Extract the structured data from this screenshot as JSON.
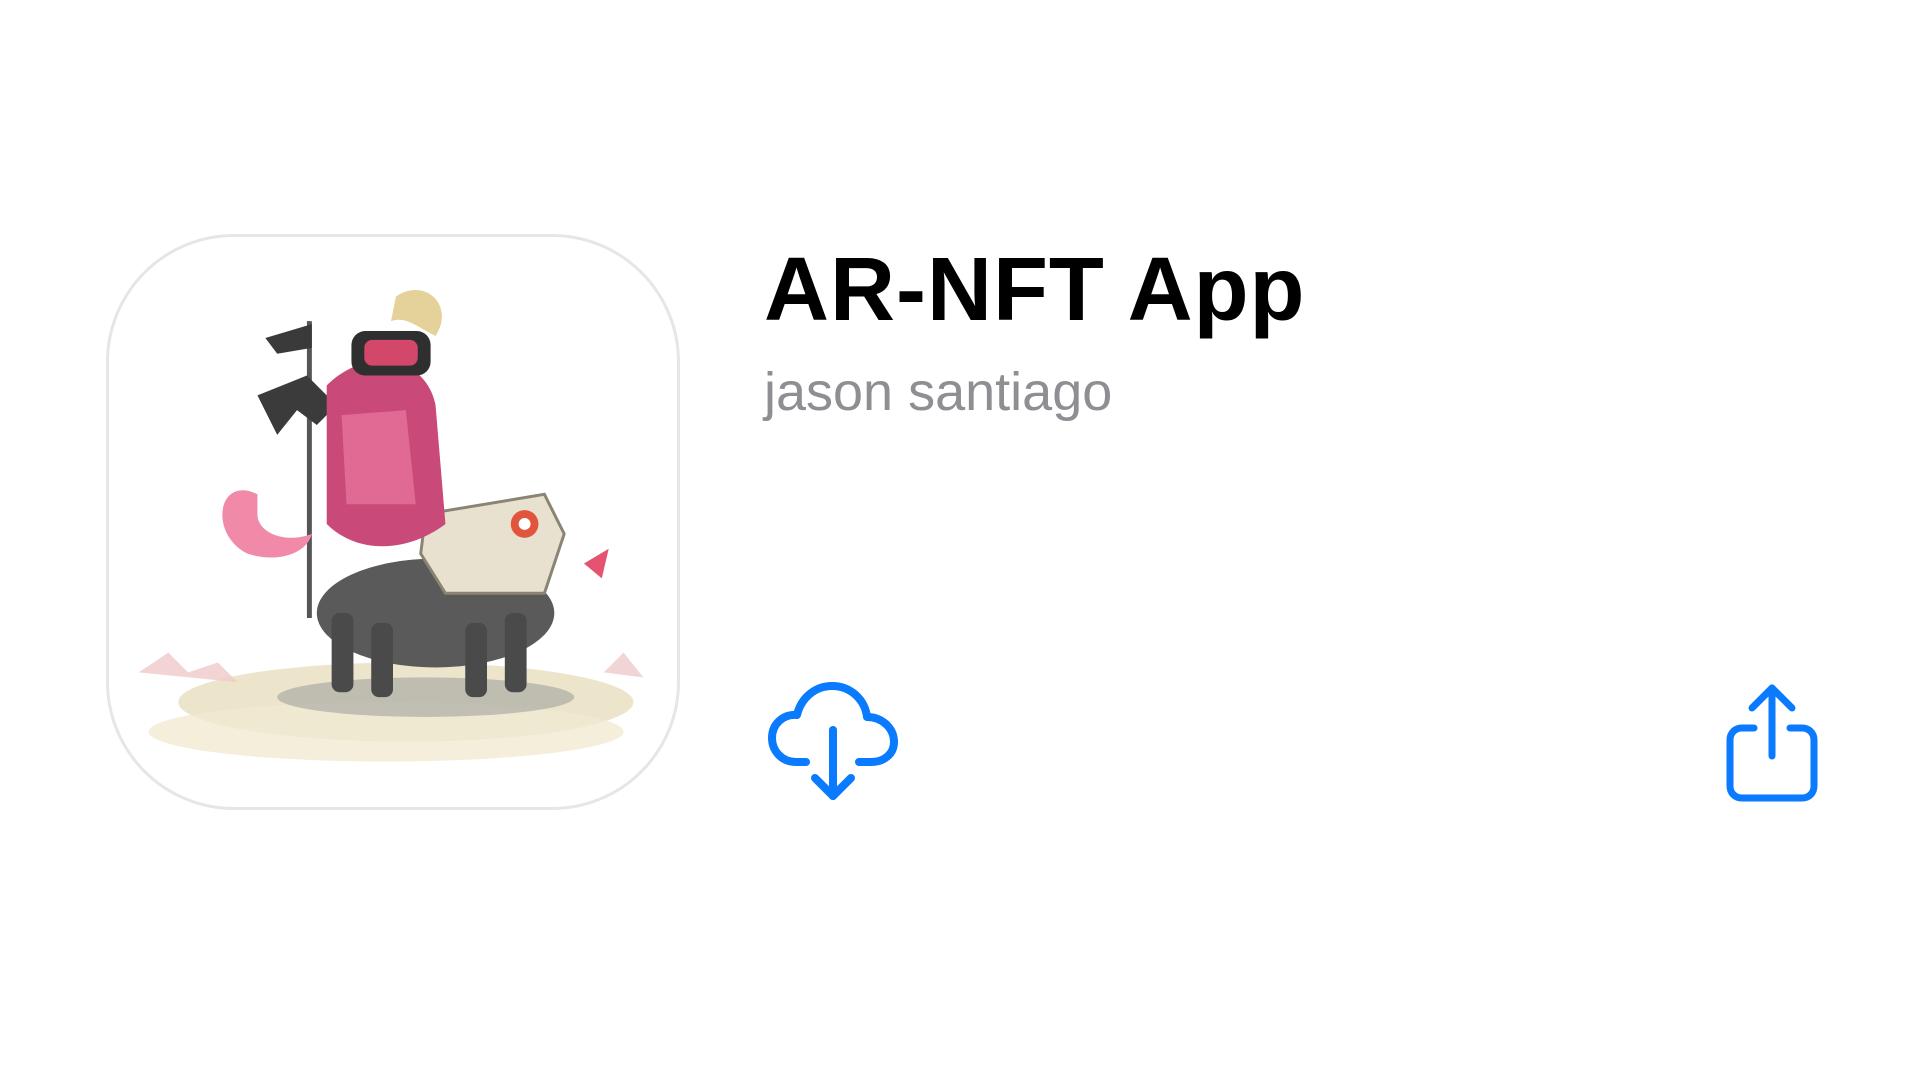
{
  "app": {
    "title": "AR-NFT App",
    "developer": "jason santiago"
  },
  "icons": {
    "app_icon": "app-artwork-icon",
    "download": "cloud-download-icon",
    "share": "share-icon"
  },
  "colors": {
    "accent": "#0a7aff",
    "title": "#000000",
    "subtitle": "#8e8e93",
    "background": "#ffffff"
  }
}
